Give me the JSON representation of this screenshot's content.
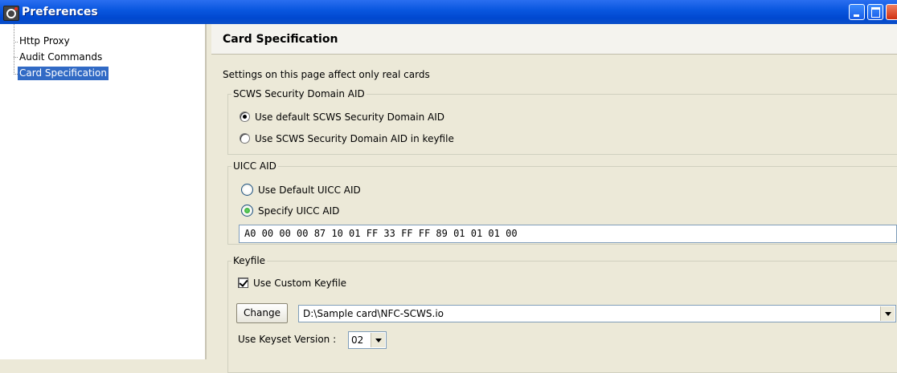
{
  "window": {
    "title": "Preferences"
  },
  "tree": {
    "items": [
      {
        "label": "Http Proxy",
        "selected": false
      },
      {
        "label": "Audit Commands",
        "selected": false
      },
      {
        "label": "Card Specification",
        "selected": true
      }
    ]
  },
  "panel": {
    "title": "Card Specification",
    "note": "Settings on this page affect only real cards",
    "scws": {
      "legend": "SCWS Security Domain AID",
      "options": [
        {
          "label": "Use default SCWS Security Domain AID",
          "selected": true
        },
        {
          "label": "Use SCWS Security Domain AID in keyfile",
          "selected": false
        }
      ]
    },
    "uicc": {
      "legend": "UICC AID",
      "options": [
        {
          "label": "Use Default UICC AID",
          "selected": false
        },
        {
          "label": "Specify UICC AID",
          "selected": true
        }
      ],
      "aid_value": "A0 00 00 00 87 10 01 FF 33 FF FF 89 01 01 01 00"
    },
    "keyfile": {
      "legend": "Keyfile",
      "use_custom_label": "Use Custom Keyfile",
      "use_custom_checked": true,
      "change_label": "Change",
      "path_value": "D:\\Sample card\\NFC-SCWS.io",
      "keyset_label": "Use Keyset Version :",
      "keyset_value": "02"
    }
  }
}
